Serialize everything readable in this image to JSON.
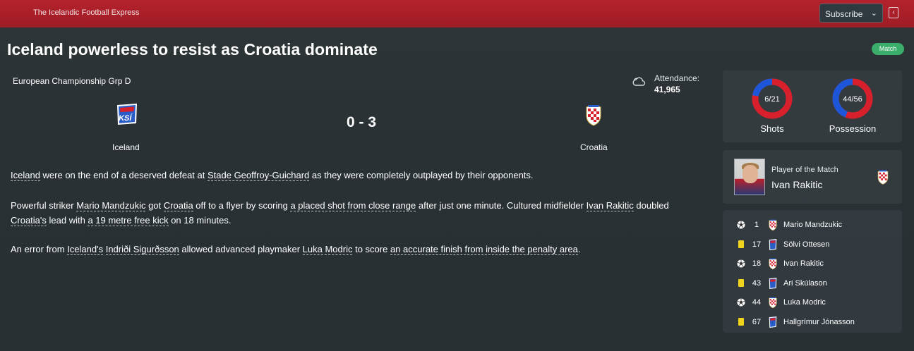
{
  "header": {
    "publication": "The Icelandic Football Express",
    "subscribe_label": "Subscribe",
    "back_icon": "collapse-left-icon",
    "accent_color": "#a91f28"
  },
  "article": {
    "headline": "Iceland powerless to resist as Croatia dominate",
    "category_badge": "Match",
    "paragraphs": [
      [
        {
          "t": "Iceland",
          "u": true
        },
        {
          "t": " were on the end of a deserved defeat at ",
          "u": false
        },
        {
          "t": "Stade Geoffroy-Guichard",
          "u": true
        },
        {
          "t": " as they were completely outplayed by their opponents.",
          "u": false
        }
      ],
      [
        {
          "t": "Powerful striker ",
          "u": false
        },
        {
          "t": "Mario Mandzukic",
          "u": true
        },
        {
          "t": " got ",
          "u": false
        },
        {
          "t": "Croatia",
          "u": true
        },
        {
          "t": " off to a flyer by scoring ",
          "u": false
        },
        {
          "t": "a placed shot from close range",
          "u": true
        },
        {
          "t": " after just one minute. Cultured midfielder ",
          "u": false
        },
        {
          "t": "Ivan Rakitic",
          "u": true
        },
        {
          "t": " doubled ",
          "u": false
        },
        {
          "t": "Croatia's",
          "u": true
        },
        {
          "t": " lead with ",
          "u": false
        },
        {
          "t": "a 19 metre free kick",
          "u": true
        },
        {
          "t": " on 18 minutes.",
          "u": false
        }
      ],
      [
        {
          "t": "An error from ",
          "u": false
        },
        {
          "t": "Iceland's",
          "u": true
        },
        {
          "t": " ",
          "u": false
        },
        {
          "t": "Indriði Sigurðsson",
          "u": true
        },
        {
          "t": " allowed advanced playmaker ",
          "u": false
        },
        {
          "t": "Luka Modric",
          "u": true
        },
        {
          "t": " to score ",
          "u": false
        },
        {
          "t": "an accurate finish from inside the penalty area",
          "u": true
        },
        {
          "t": ".",
          "u": false
        }
      ]
    ]
  },
  "match": {
    "competition": "European Championship Grp D",
    "weather_icon": "cloudy-icon",
    "attendance_label": "Attendance:",
    "attendance_value": "41,965",
    "home_team": "Iceland",
    "away_team": "Croatia",
    "score": "0 - 3"
  },
  "stats": {
    "shots": {
      "label": "Shots",
      "text": "6/21",
      "home": 6,
      "away": 21
    },
    "possession": {
      "label": "Possession",
      "text": "44/56",
      "home": 44,
      "away": 56
    },
    "home_color": "#1d56d8",
    "away_color": "#d8202c"
  },
  "player_of_match": {
    "label": "Player of the Match",
    "name": "Ivan Rakitic"
  },
  "events": [
    {
      "type": "goal",
      "icon": "ball-icon",
      "minute": "1",
      "team": "croatia",
      "player": "Mario Mandzukic"
    },
    {
      "type": "yellow",
      "icon": "yellow-card-icon",
      "minute": "17",
      "team": "iceland",
      "player": "Sölvi Ottesen"
    },
    {
      "type": "goal",
      "icon": "ball-icon",
      "minute": "18",
      "team": "croatia",
      "player": "Ivan Rakitic"
    },
    {
      "type": "yellow",
      "icon": "yellow-card-icon",
      "minute": "43",
      "team": "iceland",
      "player": "Ari Skúlason"
    },
    {
      "type": "goal",
      "icon": "ball-icon",
      "minute": "44",
      "team": "croatia",
      "player": "Luka Modric"
    },
    {
      "type": "yellow",
      "icon": "yellow-card-icon",
      "minute": "67",
      "team": "iceland",
      "player": "Hallgrímur Jónasson"
    }
  ]
}
